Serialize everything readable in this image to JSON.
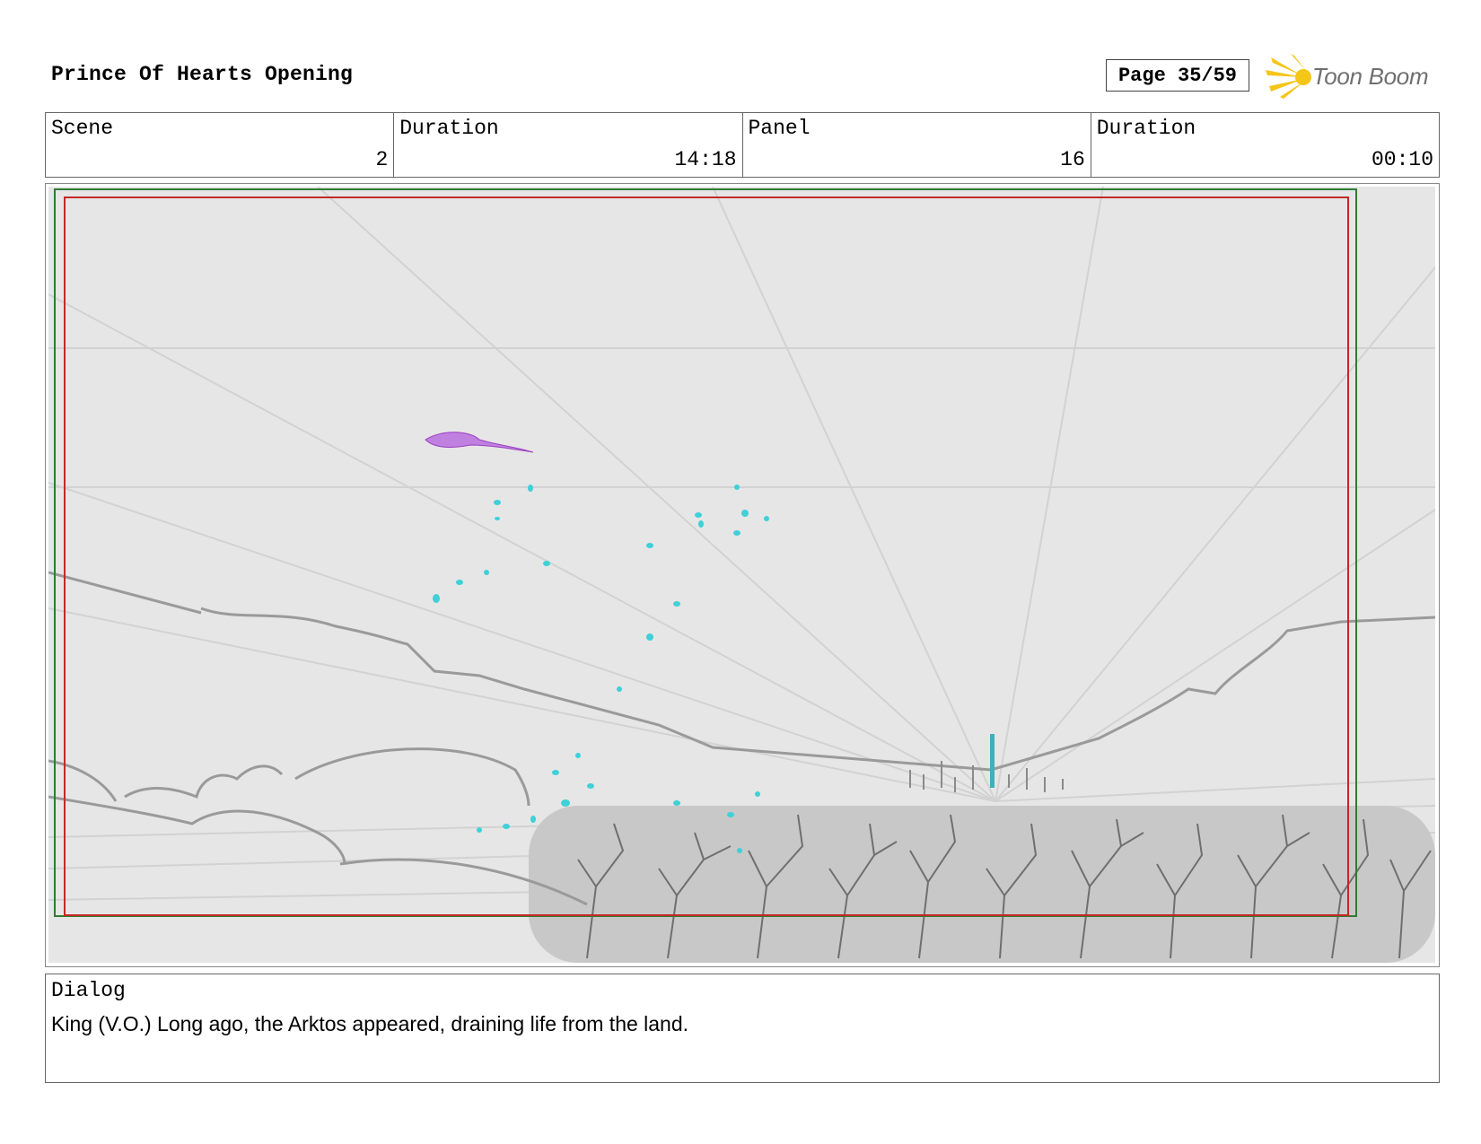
{
  "header": {
    "title": "Prince Of Hearts Opening",
    "page": "Page 35/59",
    "logo_text": "Toon Boom"
  },
  "info": {
    "scene_label": "Scene",
    "scene_value": "2",
    "scene_duration_label": "Duration",
    "scene_duration_value": "14:18",
    "panel_label": "Panel",
    "panel_value": "16",
    "panel_duration_label": "Duration",
    "panel_duration_value": "00:10"
  },
  "dialog": {
    "label": "Dialog",
    "text": "King (V.O.) Long ago, the Arktos appeared, draining life from the land."
  },
  "colors": {
    "safe_frame_green": "#2e7d32",
    "action_frame_red": "#c62828",
    "sketch_gray": "#8a8a8a",
    "particles_cyan": "#3fd0d8",
    "creature_purple": "#b060d0",
    "logo_yellow": "#f5c518"
  }
}
